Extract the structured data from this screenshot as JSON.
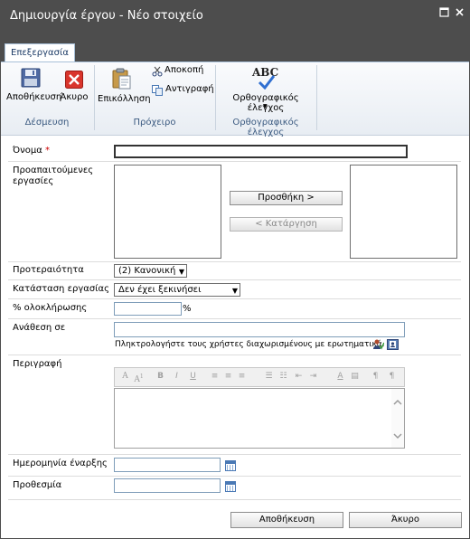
{
  "window": {
    "title": "Δημιουργία έργου - Νέο στοιχείο",
    "maximize_icon": "maximize-icon",
    "close_icon": "close-icon"
  },
  "ribbon": {
    "tab_label": "Επεξεργασία",
    "groups": {
      "commit": {
        "label": "Δέσμευση",
        "save_label": "Αποθήκευση",
        "cancel_label": "Άκυρο"
      },
      "clipboard": {
        "label": "Πρόχειρο",
        "paste_label": "Επικόλληση",
        "cut_label": "Αποκοπή",
        "copy_label": "Αντιγραφή"
      },
      "spelling": {
        "label": "Ορθογραφικός έλεγχος",
        "spelling_label": "Ορθογραφικός έλεγχος",
        "abc": "ABC"
      }
    }
  },
  "form": {
    "name": {
      "label": "Όνομα",
      "required_mark": "*",
      "value": ""
    },
    "predecessors": {
      "label": "Προαπαιτούμενες εργασίες",
      "add_label": "Προσθήκη >",
      "remove_label": "< Κατάργηση"
    },
    "priority": {
      "label": "Προτεραιότητα",
      "value": "(2) Κανονική"
    },
    "status": {
      "label": "Κατάσταση εργασίας",
      "value": "Δεν έχει ξεκινήσει"
    },
    "percent": {
      "label": "% ολοκλήρωσης",
      "suffix": "%",
      "value": ""
    },
    "assigned": {
      "label": "Ανάθεση σε",
      "value": "",
      "hint": "Πληκτρολογήστε τους χρήστες διαχωρισμένους με ερωτηματικά."
    },
    "description": {
      "label": "Περιγραφή",
      "value": ""
    },
    "start_date": {
      "label": "Ημερομηνία έναρξης",
      "value": ""
    },
    "due_date": {
      "label": "Προθεσμία",
      "value": ""
    }
  },
  "footer": {
    "save_label": "Αποθήκευση",
    "cancel_label": "Άκυρο"
  },
  "colors": {
    "titlebar": "#4d4d4d",
    "accent": "#3b5a80",
    "required": "#cc0000"
  }
}
